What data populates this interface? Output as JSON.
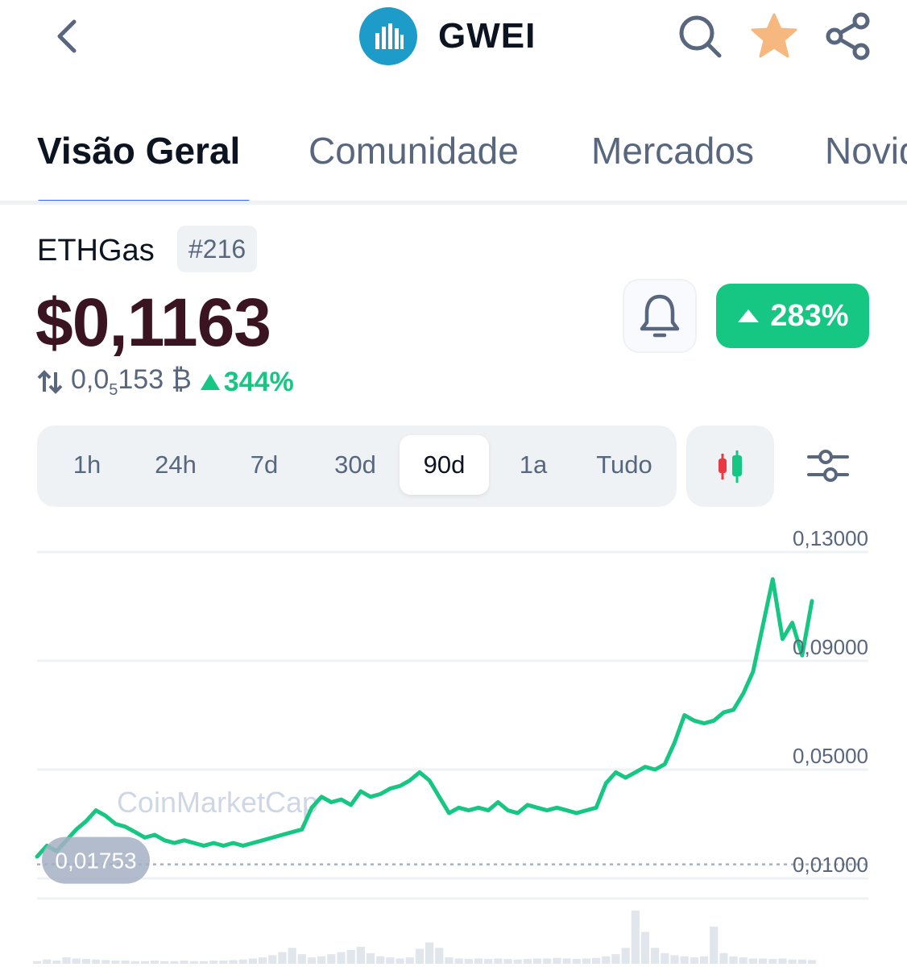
{
  "header": {
    "symbol": "GWEI",
    "icons": [
      "back-icon",
      "search-icon",
      "star-icon",
      "share-icon"
    ],
    "star_color": "#f6b87e",
    "logo_color": "#1d9bc9"
  },
  "tabs": [
    {
      "label": "Visão Geral",
      "active": true
    },
    {
      "label": "Comunidade",
      "active": false
    },
    {
      "label": "Mercados",
      "active": false
    },
    {
      "label": "Novidades",
      "active": false
    }
  ],
  "coin": {
    "name": "ETHGas",
    "rank": "#216",
    "price": "$0,1163",
    "btc_price_prefix": "0,0",
    "btc_price_sub": "5",
    "btc_price_suffix": "153",
    "btc_symbol": "₿",
    "btc_change": "344%",
    "change": "283%",
    "up_color": "#16c784"
  },
  "ranges": [
    {
      "label": "1h",
      "active": false
    },
    {
      "label": "24h",
      "active": false
    },
    {
      "label": "7d",
      "active": false
    },
    {
      "label": "30d",
      "active": false
    },
    {
      "label": "90d",
      "active": true
    },
    {
      "label": "1a",
      "active": false
    },
    {
      "label": "Tudo",
      "active": false
    }
  ],
  "chart_data": {
    "type": "line",
    "y_ticks": [
      "0,13000",
      "0,09000",
      "0,05000",
      "0,01000"
    ],
    "y_tick_values": [
      0.13,
      0.09,
      0.05,
      0.01
    ],
    "ylim": [
      0.01,
      0.13
    ],
    "start_label": "0,01753",
    "start_value": 0.01753,
    "watermark": "CoinMarketCap",
    "line_color": "#16c784",
    "grid": true,
    "values": [
      0.018,
      0.022,
      0.02,
      0.024,
      0.028,
      0.031,
      0.035,
      0.033,
      0.03,
      0.029,
      0.027,
      0.025,
      0.026,
      0.024,
      0.023,
      0.024,
      0.023,
      0.022,
      0.023,
      0.022,
      0.023,
      0.022,
      0.023,
      0.024,
      0.025,
      0.026,
      0.027,
      0.028,
      0.036,
      0.04,
      0.038,
      0.039,
      0.037,
      0.042,
      0.04,
      0.041,
      0.043,
      0.044,
      0.046,
      0.049,
      0.046,
      0.04,
      0.034,
      0.036,
      0.035,
      0.036,
      0.035,
      0.038,
      0.035,
      0.034,
      0.037,
      0.036,
      0.035,
      0.036,
      0.035,
      0.034,
      0.035,
      0.036,
      0.045,
      0.049,
      0.047,
      0.049,
      0.051,
      0.05,
      0.052,
      0.06,
      0.07,
      0.068,
      0.067,
      0.068,
      0.071,
      0.072,
      0.078,
      0.086,
      0.103,
      0.12,
      0.098,
      0.104,
      0.092,
      0.112
    ],
    "volume": [
      0.05,
      0.08,
      0.06,
      0.12,
      0.1,
      0.09,
      0.08,
      0.07,
      0.06,
      0.06,
      0.05,
      0.05,
      0.06,
      0.05,
      0.05,
      0.06,
      0.05,
      0.05,
      0.06,
      0.06,
      0.07,
      0.08,
      0.1,
      0.12,
      0.16,
      0.22,
      0.3,
      0.18,
      0.12,
      0.14,
      0.18,
      0.22,
      0.26,
      0.32,
      0.2,
      0.14,
      0.12,
      0.1,
      0.12,
      0.28,
      0.4,
      0.3,
      0.12,
      0.1,
      0.09,
      0.1,
      0.09,
      0.1,
      0.09,
      0.08,
      0.09,
      0.1,
      0.1,
      0.11,
      0.1,
      0.09,
      0.1,
      0.11,
      0.14,
      0.18,
      0.3,
      1.0,
      0.6,
      0.3,
      0.2,
      0.16,
      0.14,
      0.12,
      0.14,
      0.7,
      0.2,
      0.14,
      0.12,
      0.1,
      0.1,
      0.09,
      0.1,
      0.08,
      0.08,
      0.07
    ]
  }
}
